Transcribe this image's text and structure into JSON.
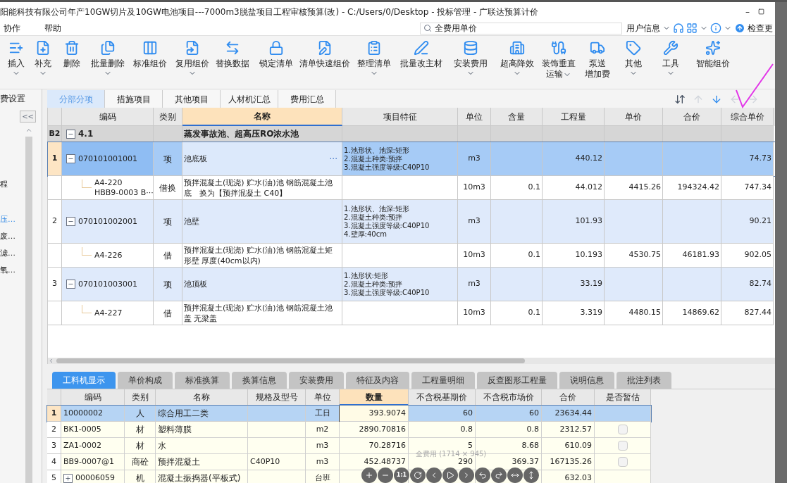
{
  "window": {
    "title": "阳能科技有限公司年产10GW切片及10GW电池项目---7000m3脱盐项目工程审核预算(改) - C:/Users/0/Desktop - 投标管理 - 广联达预算计价",
    "minimize": "–"
  },
  "menu": [
    "协作",
    "帮助"
  ],
  "search": {
    "value": "全费用单价"
  },
  "user_menu": {
    "label": "用户信息",
    "check_update": "检查更"
  },
  "toolbar": [
    {
      "label": "插入",
      "dropdown": true
    },
    {
      "label": "补充",
      "dropdown": true
    },
    {
      "label": "删除",
      "dropdown": false
    },
    {
      "label": "批量删除",
      "dropdown": true
    },
    {
      "label": "标准组价",
      "dropdown": false
    },
    {
      "label": "复用组价",
      "dropdown": true
    },
    {
      "label": "替换数据",
      "dropdown": false
    },
    {
      "label": "锁定清单",
      "dropdown": false
    },
    {
      "label": "清单快速组价",
      "dropdown": false
    },
    {
      "label": "整理清单",
      "dropdown": true
    },
    {
      "label": "批量改主材",
      "dropdown": false
    },
    {
      "label": "安装费用",
      "dropdown": true
    },
    {
      "label": "超高降效",
      "dropdown": true
    },
    {
      "label": "装饰垂直",
      "label2": "运输",
      "dropdown": true
    },
    {
      "label": "泵送",
      "label2": "增加费",
      "dropdown": false
    },
    {
      "label": "其他",
      "dropdown": true
    },
    {
      "label": "工具",
      "dropdown": true
    },
    {
      "label": "智能组价",
      "dropdown": false
    }
  ],
  "sidebar": {
    "collapse": "<<",
    "items": [
      {
        "label": "程",
        "selected": false
      },
      {
        "label": "压…",
        "selected": true
      },
      {
        "label": "废…",
        "selected": false
      },
      {
        "label": "滤…",
        "selected": false
      },
      {
        "label": "氧…",
        "selected": false
      }
    ]
  },
  "tabs": [
    {
      "label": "费设置",
      "selected": false
    },
    {
      "label": "分部分项",
      "selected": true
    },
    {
      "label": "措施项目",
      "selected": false
    },
    {
      "label": "其他项目",
      "selected": false
    },
    {
      "label": "人材机汇总",
      "selected": false
    },
    {
      "label": "费用汇总",
      "selected": false
    }
  ],
  "table": {
    "columns": [
      {
        "label": "编码",
        "selected": false
      },
      {
        "label": "类别",
        "selected": false
      },
      {
        "label": "名称",
        "selected": true
      },
      {
        "label": "项目特征",
        "selected": false
      },
      {
        "label": "单位",
        "selected": false
      },
      {
        "label": "含量",
        "selected": false
      },
      {
        "label": "工程量",
        "selected": false
      },
      {
        "label": "单价",
        "selected": false
      },
      {
        "label": "合价",
        "selected": false
      },
      {
        "label": "综合单价",
        "selected": false
      }
    ],
    "rows": [
      {
        "kind": "group",
        "num": "B2",
        "expanded": true,
        "code": [
          "4.1"
        ],
        "name": "蒸发事故池、超高压RO浓水池",
        "selected": false
      },
      {
        "kind": "item",
        "num": "1",
        "expanded": true,
        "code": [
          "070101001001"
        ],
        "type": "项",
        "name": "池底板",
        "more": "···",
        "features": [
          "1.池形状、池深:矩形",
          "2.混凝土种类:预拌",
          "3.混凝土强度等级:C40P10"
        ],
        "unit": "m3",
        "qty": "440.12",
        "composite": "74.73",
        "selected": true
      },
      {
        "kind": "sub",
        "code": [
          "A4-220",
          "HBB9-0003 B···"
        ],
        "type": "借换",
        "name": "预拌混凝土(现浇) 贮水(油)池 钢筋混凝土池底　换为【预拌混凝土 C40】",
        "unit": "10m3",
        "content": "0.1",
        "qty": "44.012",
        "price": "4415.26",
        "total": "194324.42",
        "composite": "747.34",
        "selected": false
      },
      {
        "kind": "item",
        "num": "2",
        "expanded": true,
        "code": [
          "070101002001"
        ],
        "type": "项",
        "name": "池壁",
        "features": [
          "1.池形状、池深:矩形",
          "2.混凝土种类:预拌",
          "3.混凝土强度等级:C40P10",
          "4.壁厚:40cm"
        ],
        "unit": "m3",
        "qty": "101.93",
        "composite": "90.21",
        "selected": false
      },
      {
        "kind": "sub",
        "code": [
          "A4-226"
        ],
        "type": "借",
        "name": "预拌混凝土(现浇) 贮水(油)池 钢筋混凝土矩形壁 厚度(40cm以内)",
        "unit": "10m3",
        "content": "0.1",
        "qty": "10.193",
        "price": "4530.75",
        "total": "46181.93",
        "composite": "902.05",
        "selected": false
      },
      {
        "kind": "item",
        "num": "3",
        "expanded": true,
        "code": [
          "070101003001"
        ],
        "type": "项",
        "name": "池顶板",
        "features": [
          "1.池形状:矩形",
          "2.混凝土种类:预拌",
          "3.混凝土强度等级:C40P10"
        ],
        "unit": "m3",
        "qty": "33.19",
        "composite": "82.74",
        "selected": false
      },
      {
        "kind": "sub",
        "code": [
          "A4-227"
        ],
        "type": "借",
        "name": "预拌混凝土(现浇) 贮水(油)池 钢筋混凝土池盖 无梁盖",
        "unit": "10m3",
        "content": "0.1",
        "qty": "3.319",
        "price": "4480.15",
        "total": "14869.62",
        "composite": "827.44",
        "selected": false
      }
    ]
  },
  "bottom_tabs": [
    {
      "label": "工料机显示",
      "selected": true
    },
    {
      "label": "单价构成",
      "selected": false
    },
    {
      "label": "标准换算",
      "selected": false
    },
    {
      "label": "换算信息",
      "selected": false
    },
    {
      "label": "安装费用",
      "selected": false
    },
    {
      "label": "特征及内容",
      "selected": false
    },
    {
      "label": "工程量明细",
      "selected": false
    },
    {
      "label": "反查图形工程量",
      "selected": false
    },
    {
      "label": "说明信息",
      "selected": false
    },
    {
      "label": "批注列表",
      "selected": false
    }
  ],
  "materials": {
    "columns": [
      {
        "label": "编码",
        "selected": false
      },
      {
        "label": "类别",
        "selected": false
      },
      {
        "label": "名称",
        "selected": false
      },
      {
        "label": "规格及型号",
        "selected": false
      },
      {
        "label": "单位",
        "selected": false
      },
      {
        "label": "数量",
        "selected": true
      },
      {
        "label": "不含税基期价",
        "selected": false
      },
      {
        "label": "不含税市场价",
        "selected": false
      },
      {
        "label": "合价",
        "selected": false
      },
      {
        "label": "是否暂估",
        "selected": false
      }
    ],
    "rows": [
      {
        "num": "1",
        "code": "10000002",
        "type": "人",
        "name": "综合用工二类",
        "unit": "工日",
        "qty": "393.9074",
        "base": "60",
        "market": "60",
        "total": "23634.44",
        "selected": true
      },
      {
        "num": "2",
        "code": "BK1-0005",
        "type": "材",
        "name": "塑料薄膜",
        "unit": "m2",
        "qty": "2890.70816",
        "base": "0.8",
        "market": "0.8",
        "total": "2312.57",
        "estimated": false,
        "selected": false
      },
      {
        "num": "3",
        "code": "ZA1-0002",
        "type": "材",
        "name": "水",
        "unit": "m3",
        "qty": "70.28716",
        "base": "5",
        "market": "8.68",
        "total": "610.09",
        "estimated": false,
        "selected": false
      },
      {
        "num": "4",
        "code": "BB9-0007@1",
        "type": "商砼",
        "name": "预拌混凝土",
        "spec": "C40P10",
        "unit": "m3",
        "qty": "452.48737",
        "base": "290",
        "market": "369.37",
        "total": "167135.26",
        "estimated": false,
        "selected": false
      },
      {
        "num": "5",
        "code": "00006059",
        "expanded": false,
        "type": "机",
        "name": "混凝土振捣器(平板式)",
        "unit": "台班",
        "total": "632.03",
        "selected": false
      }
    ]
  },
  "viewer": {
    "caption": "全费用 (1714 × 945)",
    "actual_size": "1:1"
  }
}
